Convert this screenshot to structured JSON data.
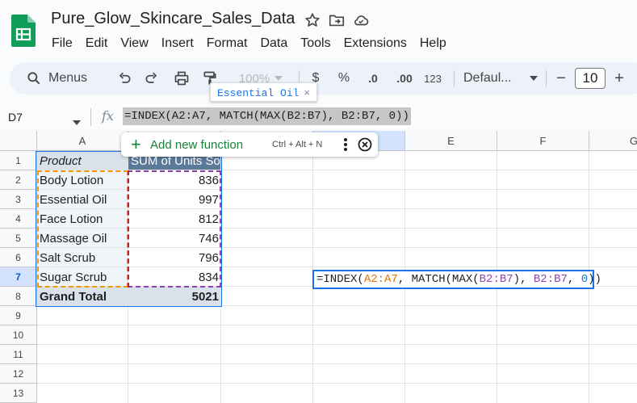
{
  "document": {
    "title": "Pure_Glow_Skincare_Sales_Data"
  },
  "menu": [
    "File",
    "Edit",
    "View",
    "Insert",
    "Format",
    "Data",
    "Tools",
    "Extensions",
    "Help"
  ],
  "toolbar": {
    "search_label": "Menus",
    "zoom": "100%",
    "currency": "$",
    "percent": "%",
    "decrease_decimal": ".0",
    "increase_decimal": ".00",
    "number_format": "123",
    "font": "Defaul...",
    "font_size": "10",
    "minus": "−",
    "plus": "+"
  },
  "formula_bar": {
    "cell_ref": "D7",
    "fx": "fx",
    "formula": "=INDEX(A2:A7, MATCH(MAX(B2:B7), B2:B7, 0))",
    "preview_chip": "Essential Oil",
    "preview_close": "×"
  },
  "add_function": {
    "label": "Add new function",
    "shortcut": "Ctrl + Alt + N"
  },
  "editing_cell": {
    "prefix": "=INDEX(",
    "range1": "A2:A7",
    "sep1": ", MATCH(MAX(",
    "range2": "B2:B7",
    "sep2": "), ",
    "range3": "B2:B7",
    "sep3": ", ",
    "zero": "0",
    "suffix": "))"
  },
  "columns": [
    "A",
    "",
    "",
    "",
    "E",
    "F",
    "G"
  ],
  "rows": [
    "1",
    "2",
    "3",
    "4",
    "5",
    "6",
    "7",
    "8",
    "9",
    "10",
    "11",
    "12",
    "13"
  ],
  "pivot": {
    "header_product": "Product",
    "header_sum": "SUM of Units Sold",
    "items": [
      {
        "product": "Body Lotion",
        "units": "836"
      },
      {
        "product": "Essential Oil",
        "units": "997"
      },
      {
        "product": "Face Lotion",
        "units": "812"
      },
      {
        "product": "Massage Oil",
        "units": "746"
      },
      {
        "product": "Salt Scrub",
        "units": "796"
      },
      {
        "product": "Sugar Scrub",
        "units": "834"
      }
    ],
    "total_label": "Grand Total",
    "total_value": "5021"
  }
}
